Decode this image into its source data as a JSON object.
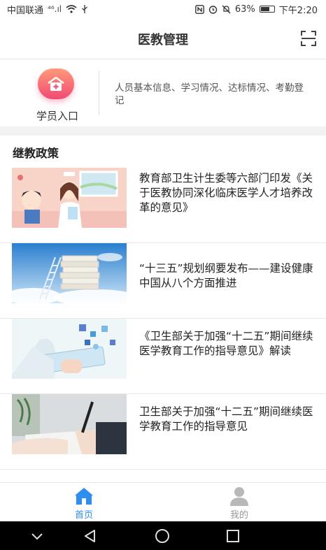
{
  "status_bar": {
    "carrier": "中国联通",
    "signal": "⁴⁶.ıl",
    "battery_percent": "63%",
    "time": "下午2:20"
  },
  "header": {
    "title": "医教管理",
    "scan_icon": "scan-icon"
  },
  "entry": {
    "label": "学员入口",
    "icon": "hospital-icon",
    "description": "人员基本信息、学习情况、达标情况、考勤登记"
  },
  "policy": {
    "section_title": "继教政策",
    "items": [
      {
        "title": "教育部卫生计生委等六部门印发《关于医教协同深化临床医学人才培养改革的意见》",
        "thumb": "nurse-illustration"
      },
      {
        "title": "“十三五”规划纲要发布——建设健康中国从八个方面推进",
        "thumb": "books-ladder-sky"
      },
      {
        "title": "《卫生部关于加强“十二五”期间继续医学教育工作的指导意见》解读",
        "thumb": "medical-tablet-icons"
      },
      {
        "title": "卫生部关于加强“十二五”期间继续医学教育工作的指导意见",
        "thumb": "hand-writing-pen"
      }
    ]
  },
  "tabbar": {
    "home_label": "首页",
    "mine_label": "我的",
    "active_color": "#2e8ef0",
    "inactive_color": "#999999"
  },
  "colors": {
    "accent": "#2e8ef0",
    "entry_gradient_top": "#ff9a7a",
    "entry_gradient_bottom": "#f04a73"
  }
}
